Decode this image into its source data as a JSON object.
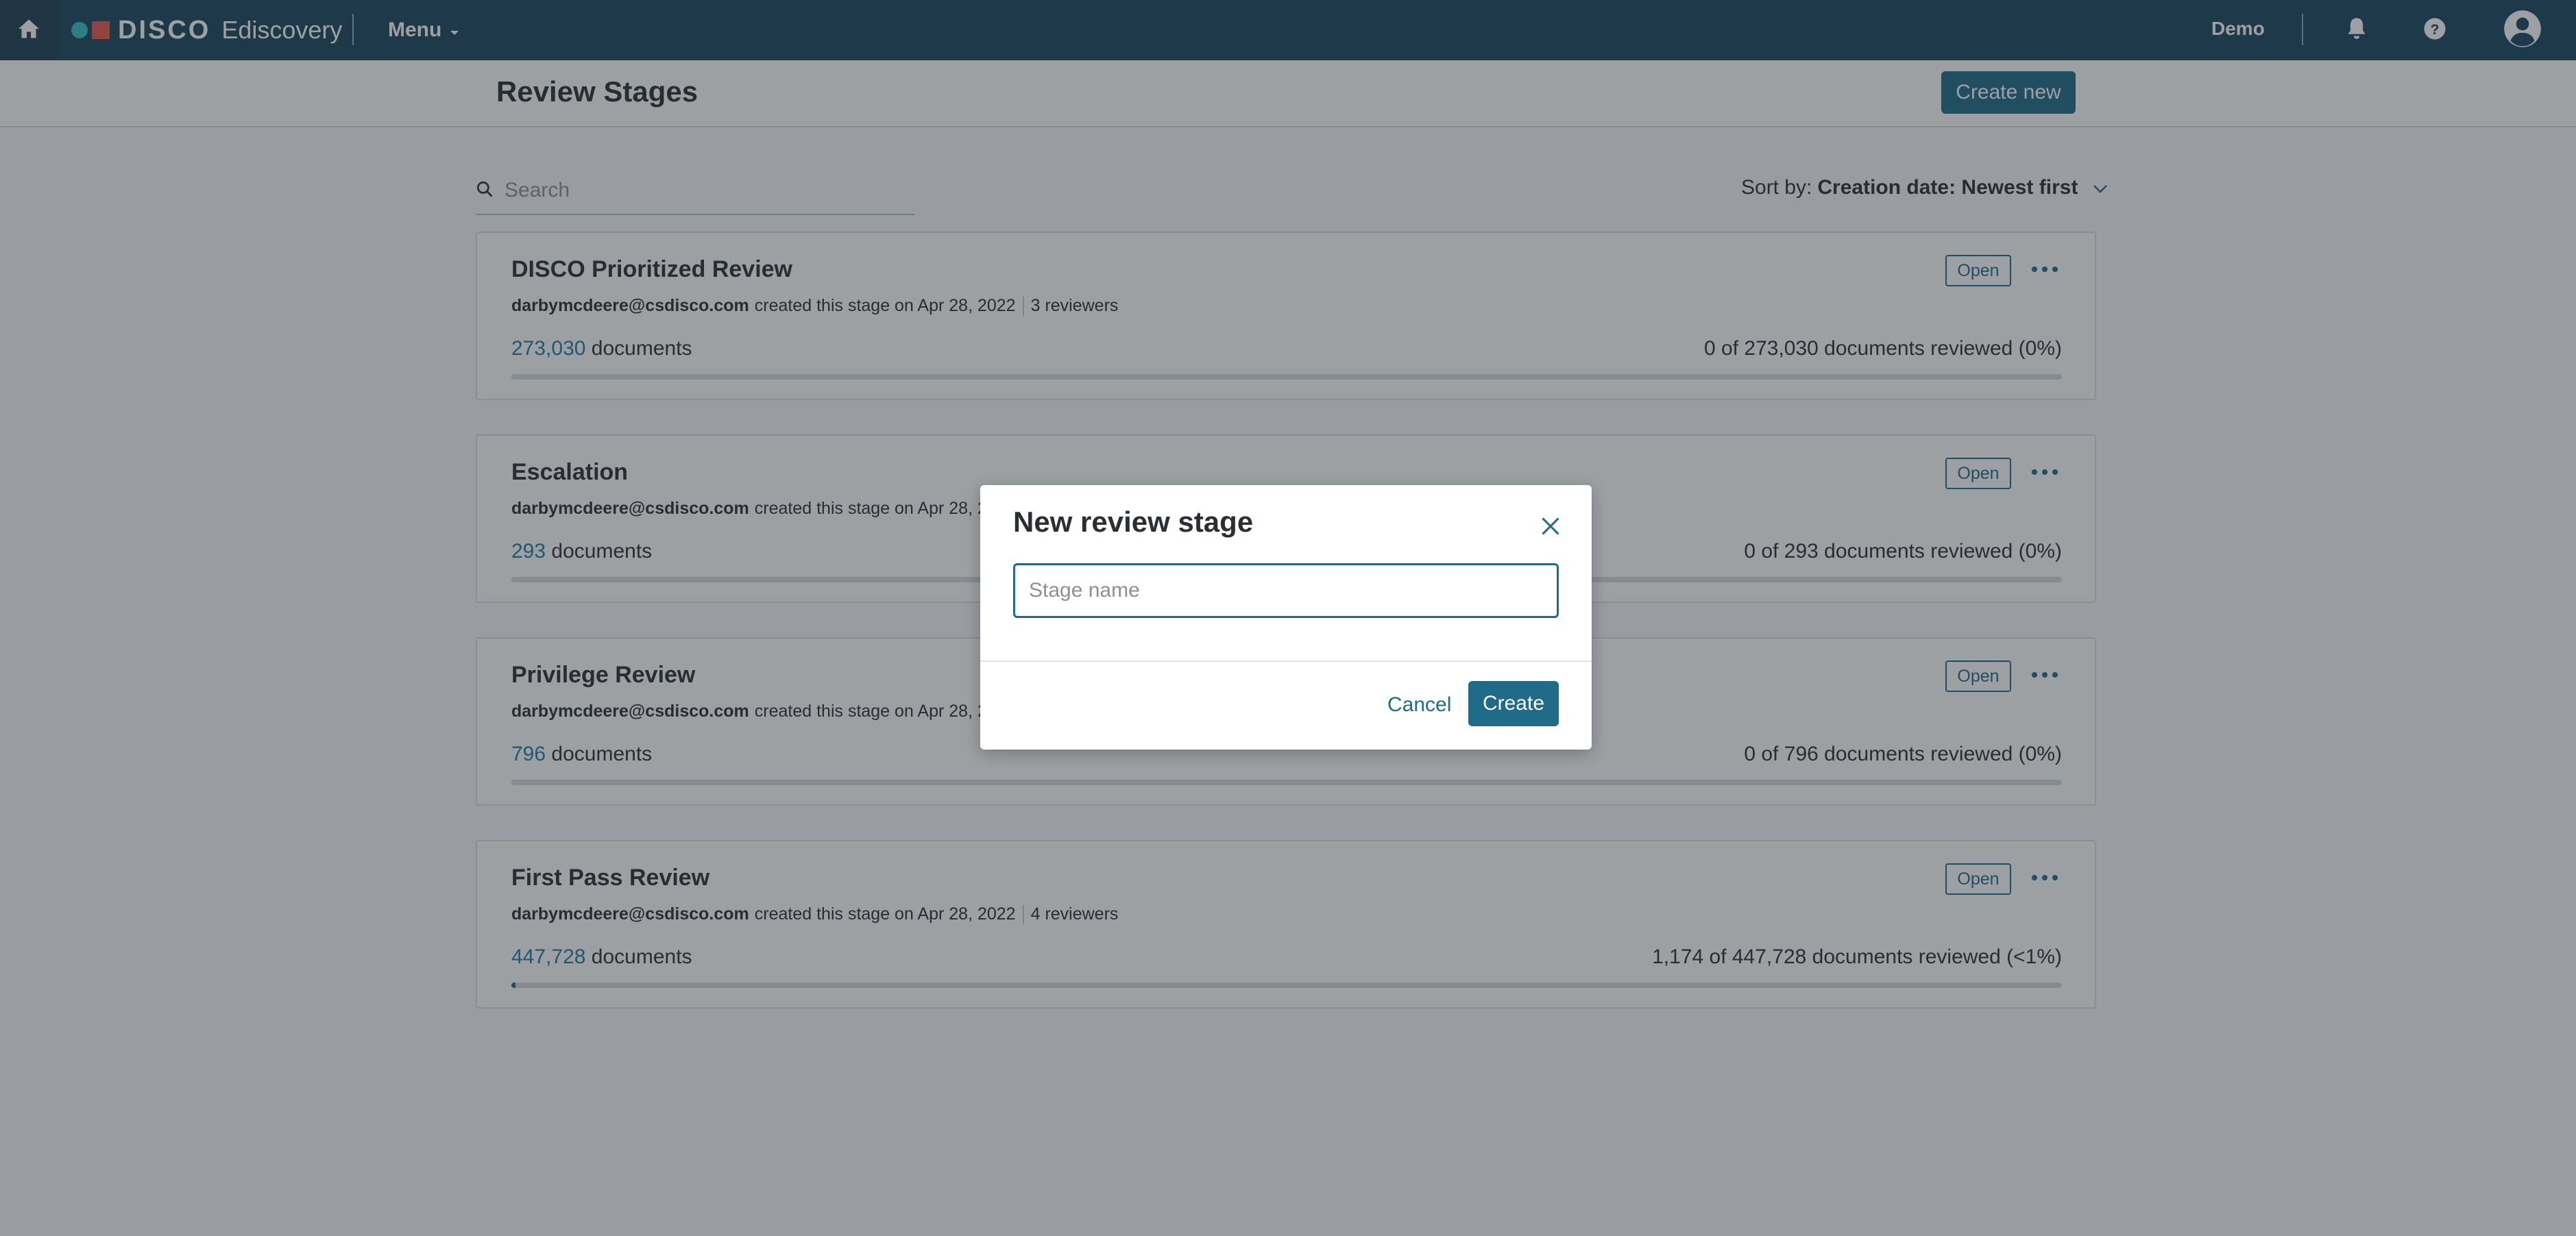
{
  "nav": {
    "brand_name": "DISCO",
    "product_name": "Ediscovery",
    "menu_label": "Menu",
    "workspace_label": "Demo",
    "icons": [
      "home-icon",
      "chevron-down-icon",
      "bell-icon",
      "help-icon",
      "user-account-icon"
    ]
  },
  "header": {
    "title": "Review Stages",
    "create_button_label": "Create new"
  },
  "toolbar": {
    "search_placeholder": "Search",
    "sort_prefix": "Sort by:",
    "sort_value": "Creation date: Newest first"
  },
  "stages": [
    {
      "name": "DISCO Prioritized Review",
      "creator": "darbymcdeere@csdisco.com",
      "created_text": "created this stage on Apr 28, 2022",
      "reviewers": "3 reviewers",
      "doc_count": "273,030",
      "doc_label": "documents",
      "progress_text": "0 of 273,030 documents reviewed (0%)",
      "progress_fraction": 0,
      "status": "Open"
    },
    {
      "name": "Escalation",
      "creator": "darbymcdeere@csdisco.com",
      "created_text": "created this stage on Apr 28, 20",
      "reviewers": "",
      "doc_count": "293",
      "doc_label": "documents",
      "progress_text": "0 of 293 documents reviewed (0%)",
      "progress_fraction": 0,
      "status": "Open"
    },
    {
      "name": "Privilege Review",
      "creator": "darbymcdeere@csdisco.com",
      "created_text": "created this stage on Apr 28, 20",
      "reviewers": "",
      "doc_count": "796",
      "doc_label": "documents",
      "progress_text": "0 of 796 documents reviewed (0%)",
      "progress_fraction": 0,
      "status": "Open"
    },
    {
      "name": "First Pass Review",
      "creator": "darbymcdeere@csdisco.com",
      "created_text": "created this stage on Apr 28, 2022",
      "reviewers": "4 reviewers",
      "doc_count": "447,728",
      "doc_label": "documents",
      "progress_text": "1,174 of 447,728 documents reviewed (<1%)",
      "progress_fraction": 0.0026,
      "status": "Open"
    }
  ],
  "modal": {
    "title": "New review stage",
    "input_placeholder": "Stage name",
    "input_value": "",
    "cancel_label": "Cancel",
    "create_label": "Create"
  },
  "colors": {
    "nav_bg": "#16445e",
    "accent": "#1f6b88",
    "link": "#1f7aa5",
    "brand_dot": "#35c0c6",
    "brand_square": "#e8584b"
  }
}
